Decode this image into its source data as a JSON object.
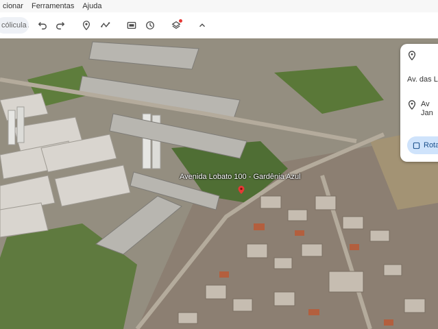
{
  "menu": {
    "items": [
      "cionar",
      "Ferramentas",
      "Ajuda"
    ]
  },
  "toolbar": {
    "search_text": "cólicula A"
  },
  "map": {
    "label": "Avenida Lobato 100 - Gardênia Azul"
  },
  "panel": {
    "row1_text": "",
    "row2_text": "Av. das L...",
    "row3_line1": "Av",
    "row3_line2": "Jan",
    "button_label": "Rota"
  },
  "colors": {
    "accent": "#1a73e8",
    "notification": "#e53935",
    "pin": "#e53935"
  }
}
